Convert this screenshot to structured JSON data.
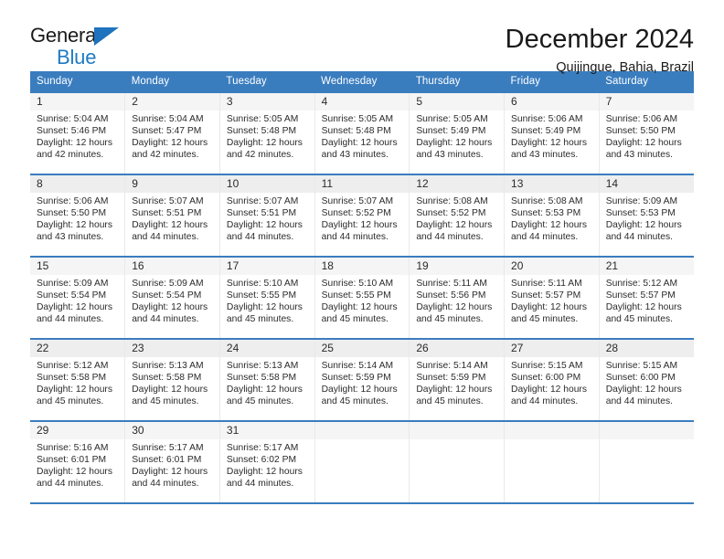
{
  "brand": {
    "name_top": "General",
    "name_bottom": "Blue",
    "triangle_color": "#1f72bd",
    "text_color_bottom": "#1f7ac4"
  },
  "header": {
    "title": "December 2024",
    "subtitle": "Quijingue, Bahia, Brazil"
  },
  "theme": {
    "header_blue": "#3a7dbf",
    "row_divider_blue": "#3a7dbf",
    "daynum_band": "#f5f5f5",
    "daynum_band_alt": "#eeeeee",
    "text": "#2b2b2b"
  },
  "weekdays": [
    "Sunday",
    "Monday",
    "Tuesday",
    "Wednesday",
    "Thursday",
    "Friday",
    "Saturday"
  ],
  "labels": {
    "sunrise_prefix": "Sunrise:",
    "sunset_prefix": "Sunset:",
    "daylight_prefix": "Daylight:"
  },
  "weeks": [
    [
      {
        "day": "1",
        "sunrise": "Sunrise: 5:04 AM",
        "sunset": "Sunset: 5:46 PM",
        "daylight1": "Daylight: 12 hours",
        "daylight2": "and 42 minutes."
      },
      {
        "day": "2",
        "sunrise": "Sunrise: 5:04 AM",
        "sunset": "Sunset: 5:47 PM",
        "daylight1": "Daylight: 12 hours",
        "daylight2": "and 42 minutes."
      },
      {
        "day": "3",
        "sunrise": "Sunrise: 5:05 AM",
        "sunset": "Sunset: 5:48 PM",
        "daylight1": "Daylight: 12 hours",
        "daylight2": "and 42 minutes."
      },
      {
        "day": "4",
        "sunrise": "Sunrise: 5:05 AM",
        "sunset": "Sunset: 5:48 PM",
        "daylight1": "Daylight: 12 hours",
        "daylight2": "and 43 minutes."
      },
      {
        "day": "5",
        "sunrise": "Sunrise: 5:05 AM",
        "sunset": "Sunset: 5:49 PM",
        "daylight1": "Daylight: 12 hours",
        "daylight2": "and 43 minutes."
      },
      {
        "day": "6",
        "sunrise": "Sunrise: 5:06 AM",
        "sunset": "Sunset: 5:49 PM",
        "daylight1": "Daylight: 12 hours",
        "daylight2": "and 43 minutes."
      },
      {
        "day": "7",
        "sunrise": "Sunrise: 5:06 AM",
        "sunset": "Sunset: 5:50 PM",
        "daylight1": "Daylight: 12 hours",
        "daylight2": "and 43 minutes."
      }
    ],
    [
      {
        "day": "8",
        "sunrise": "Sunrise: 5:06 AM",
        "sunset": "Sunset: 5:50 PM",
        "daylight1": "Daylight: 12 hours",
        "daylight2": "and 43 minutes."
      },
      {
        "day": "9",
        "sunrise": "Sunrise: 5:07 AM",
        "sunset": "Sunset: 5:51 PM",
        "daylight1": "Daylight: 12 hours",
        "daylight2": "and 44 minutes."
      },
      {
        "day": "10",
        "sunrise": "Sunrise: 5:07 AM",
        "sunset": "Sunset: 5:51 PM",
        "daylight1": "Daylight: 12 hours",
        "daylight2": "and 44 minutes."
      },
      {
        "day": "11",
        "sunrise": "Sunrise: 5:07 AM",
        "sunset": "Sunset: 5:52 PM",
        "daylight1": "Daylight: 12 hours",
        "daylight2": "and 44 minutes."
      },
      {
        "day": "12",
        "sunrise": "Sunrise: 5:08 AM",
        "sunset": "Sunset: 5:52 PM",
        "daylight1": "Daylight: 12 hours",
        "daylight2": "and 44 minutes."
      },
      {
        "day": "13",
        "sunrise": "Sunrise: 5:08 AM",
        "sunset": "Sunset: 5:53 PM",
        "daylight1": "Daylight: 12 hours",
        "daylight2": "and 44 minutes."
      },
      {
        "day": "14",
        "sunrise": "Sunrise: 5:09 AM",
        "sunset": "Sunset: 5:53 PM",
        "daylight1": "Daylight: 12 hours",
        "daylight2": "and 44 minutes."
      }
    ],
    [
      {
        "day": "15",
        "sunrise": "Sunrise: 5:09 AM",
        "sunset": "Sunset: 5:54 PM",
        "daylight1": "Daylight: 12 hours",
        "daylight2": "and 44 minutes."
      },
      {
        "day": "16",
        "sunrise": "Sunrise: 5:09 AM",
        "sunset": "Sunset: 5:54 PM",
        "daylight1": "Daylight: 12 hours",
        "daylight2": "and 44 minutes."
      },
      {
        "day": "17",
        "sunrise": "Sunrise: 5:10 AM",
        "sunset": "Sunset: 5:55 PM",
        "daylight1": "Daylight: 12 hours",
        "daylight2": "and 45 minutes."
      },
      {
        "day": "18",
        "sunrise": "Sunrise: 5:10 AM",
        "sunset": "Sunset: 5:55 PM",
        "daylight1": "Daylight: 12 hours",
        "daylight2": "and 45 minutes."
      },
      {
        "day": "19",
        "sunrise": "Sunrise: 5:11 AM",
        "sunset": "Sunset: 5:56 PM",
        "daylight1": "Daylight: 12 hours",
        "daylight2": "and 45 minutes."
      },
      {
        "day": "20",
        "sunrise": "Sunrise: 5:11 AM",
        "sunset": "Sunset: 5:57 PM",
        "daylight1": "Daylight: 12 hours",
        "daylight2": "and 45 minutes."
      },
      {
        "day": "21",
        "sunrise": "Sunrise: 5:12 AM",
        "sunset": "Sunset: 5:57 PM",
        "daylight1": "Daylight: 12 hours",
        "daylight2": "and 45 minutes."
      }
    ],
    [
      {
        "day": "22",
        "sunrise": "Sunrise: 5:12 AM",
        "sunset": "Sunset: 5:58 PM",
        "daylight1": "Daylight: 12 hours",
        "daylight2": "and 45 minutes."
      },
      {
        "day": "23",
        "sunrise": "Sunrise: 5:13 AM",
        "sunset": "Sunset: 5:58 PM",
        "daylight1": "Daylight: 12 hours",
        "daylight2": "and 45 minutes."
      },
      {
        "day": "24",
        "sunrise": "Sunrise: 5:13 AM",
        "sunset": "Sunset: 5:58 PM",
        "daylight1": "Daylight: 12 hours",
        "daylight2": "and 45 minutes."
      },
      {
        "day": "25",
        "sunrise": "Sunrise: 5:14 AM",
        "sunset": "Sunset: 5:59 PM",
        "daylight1": "Daylight: 12 hours",
        "daylight2": "and 45 minutes."
      },
      {
        "day": "26",
        "sunrise": "Sunrise: 5:14 AM",
        "sunset": "Sunset: 5:59 PM",
        "daylight1": "Daylight: 12 hours",
        "daylight2": "and 45 minutes."
      },
      {
        "day": "27",
        "sunrise": "Sunrise: 5:15 AM",
        "sunset": "Sunset: 6:00 PM",
        "daylight1": "Daylight: 12 hours",
        "daylight2": "and 44 minutes."
      },
      {
        "day": "28",
        "sunrise": "Sunrise: 5:15 AM",
        "sunset": "Sunset: 6:00 PM",
        "daylight1": "Daylight: 12 hours",
        "daylight2": "and 44 minutes."
      }
    ],
    [
      {
        "day": "29",
        "sunrise": "Sunrise: 5:16 AM",
        "sunset": "Sunset: 6:01 PM",
        "daylight1": "Daylight: 12 hours",
        "daylight2": "and 44 minutes."
      },
      {
        "day": "30",
        "sunrise": "Sunrise: 5:17 AM",
        "sunset": "Sunset: 6:01 PM",
        "daylight1": "Daylight: 12 hours",
        "daylight2": "and 44 minutes."
      },
      {
        "day": "31",
        "sunrise": "Sunrise: 5:17 AM",
        "sunset": "Sunset: 6:02 PM",
        "daylight1": "Daylight: 12 hours",
        "daylight2": "and 44 minutes."
      },
      {
        "day": "",
        "sunrise": "",
        "sunset": "",
        "daylight1": "",
        "daylight2": ""
      },
      {
        "day": "",
        "sunrise": "",
        "sunset": "",
        "daylight1": "",
        "daylight2": ""
      },
      {
        "day": "",
        "sunrise": "",
        "sunset": "",
        "daylight1": "",
        "daylight2": ""
      },
      {
        "day": "",
        "sunrise": "",
        "sunset": "",
        "daylight1": "",
        "daylight2": ""
      }
    ]
  ]
}
